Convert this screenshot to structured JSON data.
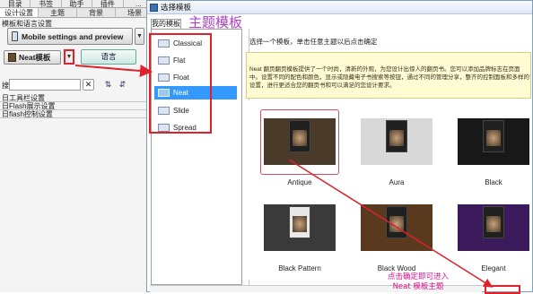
{
  "menu": [
    "目录",
    "书签",
    "助手",
    "插件",
    "..."
  ],
  "tabs": [
    {
      "label": "设计设置",
      "active": true
    },
    {
      "label": "主题",
      "active": false
    },
    {
      "label": "背景",
      "active": false
    },
    {
      "label": "场景",
      "active": false
    }
  ],
  "left": {
    "section_label": "模板和语言设置",
    "mobile_button": "Mobile settings and preview",
    "template_button": "Neat模板",
    "language_button": "语言",
    "search_label": "搜索:",
    "search_value": "",
    "tree": [
      "日工具栏设置",
      "日Flash展示设置",
      "日flash控制设置"
    ]
  },
  "dialog": {
    "title": "选择模板",
    "heading_annotation": "主题模板",
    "my_templates_tab": "我的模板",
    "templates": [
      {
        "name": "Classical",
        "selected": false
      },
      {
        "name": "Flat",
        "selected": false
      },
      {
        "name": "Float",
        "selected": false
      },
      {
        "name": "Neat",
        "selected": true
      },
      {
        "name": "Slide",
        "selected": false
      },
      {
        "name": "Spread",
        "selected": false
      }
    ],
    "instruction": "选择一个模板，单击任意主题以后点击确定",
    "info_text": "Neat 翻页翻页模板提供了一个时尚，清新的外观，为您设计出惊人的翻页书。您可以添加品牌标志在页面中。设置不同的配色和颜色，显示或隐藏电子书搜索等按钮，通过不同的管理分享，整齐的控制面板和多样的设置，进行更适合您的翻页书和可以满足的您设计要求。",
    "themes": [
      {
        "name": "Antique",
        "selected": true,
        "bg": "#4a3a2a"
      },
      {
        "name": "Aura",
        "selected": false,
        "bg": "#d8d8d8"
      },
      {
        "name": "Black",
        "selected": false,
        "bg": "#181818"
      },
      {
        "name": "Black Pattern",
        "selected": false,
        "bg": "#3a3a3a"
      },
      {
        "name": "Black Wood",
        "selected": false,
        "bg": "#5a3a1e"
      },
      {
        "name": "Elegant",
        "selected": false,
        "bg": "#3a1a5a"
      }
    ],
    "ok_annotation_line1": "点击确定即可进入",
    "ok_annotation_line2": "Neat 模板主题"
  },
  "colors": {
    "annotation_red": "#e0202a",
    "annotation_purple": "#b040c8",
    "annotation_pink": "#e01090",
    "selection_blue": "#3399ff",
    "info_bg": "#fffbd2"
  }
}
